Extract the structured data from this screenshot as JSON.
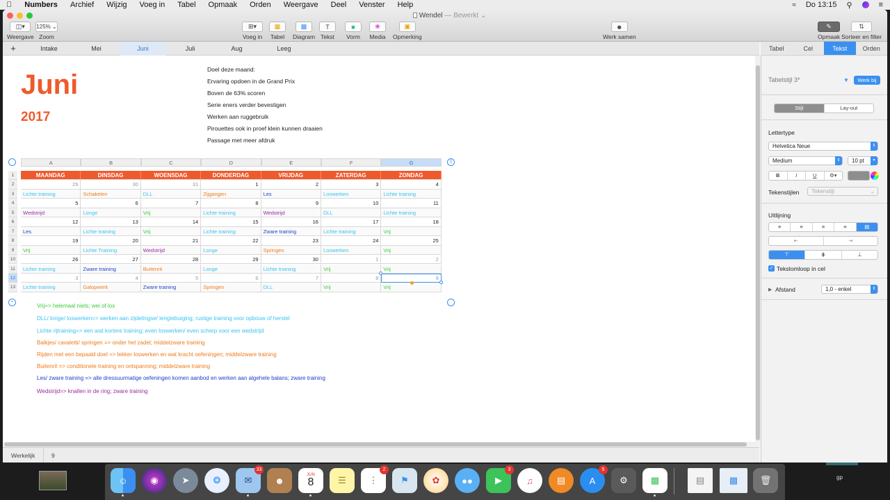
{
  "menubar": {
    "apple": "",
    "items": [
      "Numbers",
      "Archief",
      "Wijzig",
      "Voeg in",
      "Tabel",
      "Opmaak",
      "Orden",
      "Weergave",
      "Deel",
      "Venster",
      "Help"
    ],
    "clock": "Do 13:15"
  },
  "window": {
    "title": "Wendel",
    "subtitle": "— Bewerkt ⌄"
  },
  "toolbar": {
    "view_label": "Weergave",
    "zoom_value": "125% ⌄",
    "zoom_label": "Zoom",
    "insert_label": "Voeg in",
    "table_label": "Tabel",
    "chart_label": "Diagram",
    "text_label": "Tekst",
    "shape_label": "Vorm",
    "media_label": "Media",
    "comment_label": "Opmerking",
    "collab_label": "Werk samen",
    "format_label": "Opmaak",
    "sort_label": "Sorteer en filter"
  },
  "sheet_tabs": {
    "add": "+",
    "tabs": [
      "Intake",
      "Mei",
      "Juni",
      "Juli",
      "Aug",
      "Leeg"
    ],
    "active": "Juni"
  },
  "inspector": {
    "tabs": [
      "Tabel",
      "Cel",
      "Tekst",
      "Orden"
    ],
    "active_tab": "Tekst",
    "style_name": "Tabelstijl 3*",
    "update_button": "Werk bij",
    "style_seg": [
      "Stijl",
      "Lay-out"
    ],
    "font_section": "Lettertype",
    "font_family": "Helvetica Neue",
    "font_weight": "Medium",
    "font_size": "10 pt",
    "bold": "B",
    "italic": "I",
    "underline": "U",
    "char_styles_label": "Tekenstijlen",
    "char_styles_value": "Tekenstijl",
    "align_section": "Uitlijning",
    "wrap_label": "Tekstomloop in cel",
    "wrap_checked": true,
    "spacing_label": "Afstand",
    "spacing_value": "1,0 - enkel",
    "text_color": "#8e8e8e"
  },
  "content": {
    "month": "Juni",
    "year": "2017",
    "goals": [
      "Doel deze maand:",
      "Ervaring opdoen in de Grand Prix",
      "Boven de 63% scoren",
      "Serie eners verder bevestigen",
      "Werken aan ruggebruik",
      "Pirouettes ook in proef klein kunnen draaien",
      "Passage met meer afdruk"
    ]
  },
  "table": {
    "col_headers": [
      "A",
      "B",
      "C",
      "D",
      "E",
      "F",
      "G"
    ],
    "row_headers": [
      "1",
      "2",
      "3",
      "4",
      "5",
      "6",
      "7",
      "8",
      "9",
      "10",
      "11",
      "12",
      "13"
    ],
    "selected_col": "G",
    "selected_row": "12",
    "days": [
      "MAANDAG",
      "DINSDAG",
      "WOENSDAG",
      "DONDERDAG",
      "VRIJDAG",
      "ZATERDAG",
      "ZONDAG"
    ],
    "weeks": [
      {
        "nums": [
          "29",
          "30",
          "31",
          "1",
          "2",
          "3",
          "4"
        ],
        "other": [
          true,
          true,
          true,
          false,
          false,
          false,
          false
        ],
        "acts": [
          {
            "t": "Lichte training",
            "c": "lt"
          },
          {
            "t": "Schakelen",
            "c": "or"
          },
          {
            "t": "DLL",
            "c": "lt"
          },
          {
            "t": "Zijgangen",
            "c": "or"
          },
          {
            "t": "Les",
            "c": "bl"
          },
          {
            "t": "Loswerken",
            "c": "lt"
          },
          {
            "t": "Lichte training",
            "c": "lt"
          }
        ]
      },
      {
        "nums": [
          "5",
          "6",
          "7",
          "8",
          "9",
          "10",
          "11"
        ],
        "other": [
          false,
          false,
          false,
          false,
          false,
          false,
          false
        ],
        "acts": [
          {
            "t": "Wedstrijd",
            "c": "wd"
          },
          {
            "t": "Longe",
            "c": "lt"
          },
          {
            "t": "Vrij",
            "c": "vr"
          },
          {
            "t": "Lichte training",
            "c": "lt"
          },
          {
            "t": "Wedstrijd",
            "c": "wd"
          },
          {
            "t": "DLL",
            "c": "lt"
          },
          {
            "t": "Lichte training",
            "c": "lt"
          }
        ]
      },
      {
        "nums": [
          "12",
          "13",
          "14",
          "15",
          "16",
          "17",
          "18"
        ],
        "other": [
          false,
          false,
          false,
          false,
          false,
          false,
          false
        ],
        "acts": [
          {
            "t": "Les",
            "c": "bl"
          },
          {
            "t": "Lichte training",
            "c": "lt"
          },
          {
            "t": "Vrij",
            "c": "vr"
          },
          {
            "t": "Lichte training",
            "c": "lt"
          },
          {
            "t": "Zware training",
            "c": "bl"
          },
          {
            "t": "Lichte training",
            "c": "lt"
          },
          {
            "t": "Vrij",
            "c": "vr"
          }
        ]
      },
      {
        "nums": [
          "19",
          "20",
          "21",
          "22",
          "23",
          "24",
          "25"
        ],
        "other": [
          false,
          false,
          false,
          false,
          false,
          false,
          false
        ],
        "acts": [
          {
            "t": "Vrij",
            "c": "vr"
          },
          {
            "t": "Lichte Training",
            "c": "lt"
          },
          {
            "t": "Wedstrijd",
            "c": "wd"
          },
          {
            "t": "Longe",
            "c": "lt"
          },
          {
            "t": "Springen",
            "c": "or"
          },
          {
            "t": "Loswerken",
            "c": "lt"
          },
          {
            "t": "Vrij",
            "c": "vr"
          }
        ]
      },
      {
        "nums": [
          "26",
          "27",
          "28",
          "29",
          "30",
          "1",
          "2"
        ],
        "other": [
          false,
          false,
          false,
          false,
          false,
          true,
          true
        ],
        "acts": [
          {
            "t": "Lichte training",
            "c": "lt"
          },
          {
            "t": "Zware training",
            "c": "bl"
          },
          {
            "t": "Buitenrit",
            "c": "or"
          },
          {
            "t": "Longe",
            "c": "lt"
          },
          {
            "t": "Lichte training",
            "c": "lt"
          },
          {
            "t": "Vrij",
            "c": "vr"
          },
          {
            "t": "Vrij",
            "c": "vr"
          }
        ]
      },
      {
        "nums": [
          "3",
          "4",
          "5",
          "6",
          "7",
          "8",
          "9"
        ],
        "other": [
          true,
          true,
          true,
          true,
          true,
          true,
          true
        ],
        "acts": [
          {
            "t": "Lichte training",
            "c": "lt"
          },
          {
            "t": "Galopwerk",
            "c": "or"
          },
          {
            "t": "Zware training",
            "c": "bl"
          },
          {
            "t": "Springen",
            "c": "or"
          },
          {
            "t": "DLL",
            "c": "lt"
          },
          {
            "t": "Vrij",
            "c": "vr"
          },
          {
            "t": "Vrij",
            "c": "vr"
          }
        ]
      }
    ]
  },
  "legend": [
    {
      "t": "Vrij=> helemaal niets; wei of los",
      "c": "vr"
    },
    {
      "t": "DLL/ longe/ loswerken=> werken aan zijdelingse/ lengtebuiging; rustige training voor opbouw of herstel",
      "c": "lt"
    },
    {
      "t": "Lichte rijtraining=> een wat kortere training; even loswerken/ even scherp voor een wedstrijd",
      "c": "lt"
    },
    {
      "t": "Balkjes/ cavaletti/ springen => onder het zadel; middelzware training",
      "c": "or"
    },
    {
      "t": "Rijden met een bepaald doel => lekker loswerken en wat kracht oefeningen; middelzware training",
      "c": "or"
    },
    {
      "t": "Buitenrit => conditionele training en ontspanning; middelzware training",
      "c": "or"
    },
    {
      "t": "Les/ zware training => alle dressuurmatige oefeningen komen aanbod en werken aan algehele balans; zware training",
      "c": "bl"
    },
    {
      "t": "Wedstrijd=> knallen in de ring; zware training",
      "c": "wd"
    }
  ],
  "status": {
    "label": "Werkelijk",
    "value": "9"
  },
  "dock": {
    "mail_badge": "33",
    "calendar_month": "JUN",
    "calendar_day": "8",
    "reminders_badge": "2",
    "facetime_badge": "3",
    "appstore_badge": "5",
    "user_initials": "gp"
  },
  "colors": {
    "accent": "#ef5a2c",
    "blue": "#3b8ff0",
    "lt": "#38c3f0",
    "wd": "#9c2aa0",
    "vr": "#3fca35",
    "or": "#f07a1a",
    "bl": "#1f3ec9"
  }
}
